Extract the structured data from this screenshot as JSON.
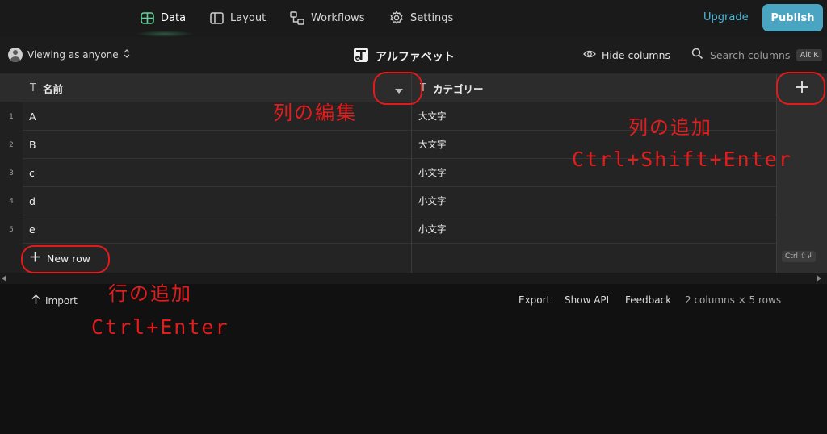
{
  "nav": {
    "items": [
      {
        "label": "Data",
        "icon": "table-icon",
        "active": true
      },
      {
        "label": "Layout",
        "icon": "layout-icon",
        "active": false
      },
      {
        "label": "Workflows",
        "icon": "workflows-icon",
        "active": false
      },
      {
        "label": "Settings",
        "icon": "gear-icon",
        "active": false
      }
    ],
    "upgrade": "Upgrade",
    "publish": "Publish",
    "accent": "#4aa5c2",
    "active_color": "#50c88c"
  },
  "toolbar": {
    "viewing": "Viewing as anyone",
    "table_title": "アルファベット",
    "hide_columns": "Hide columns",
    "search_placeholder": "Search columns",
    "search_shortcut": "Alt K"
  },
  "grid": {
    "columns": [
      {
        "name": "名前",
        "type_icon": "text-type-icon"
      },
      {
        "name": "カテゴリー",
        "type_icon": "text-type-icon"
      }
    ],
    "rows": [
      {
        "num": "1",
        "name": "A",
        "category": "大文字"
      },
      {
        "num": "2",
        "name": "B",
        "category": "大文字"
      },
      {
        "num": "3",
        "name": "c",
        "category": "小文字"
      },
      {
        "num": "4",
        "name": "d",
        "category": "小文字"
      },
      {
        "num": "5",
        "name": "e",
        "category": "小文字"
      }
    ],
    "new_row": "New row",
    "add_column_shortcut": "Ctrl ⇧↲"
  },
  "footer": {
    "import": "Import",
    "export": "Export",
    "show_api": "Show API",
    "feedback": "Feedback",
    "summary": "2 columns × 5 rows"
  },
  "annotations": {
    "edit_column": "列の編集",
    "add_column": "列の追加",
    "add_column_key": "Ctrl+Shift+Enter",
    "add_row": "行の追加",
    "add_row_key": "Ctrl+Enter",
    "color": "#e21d1d"
  }
}
